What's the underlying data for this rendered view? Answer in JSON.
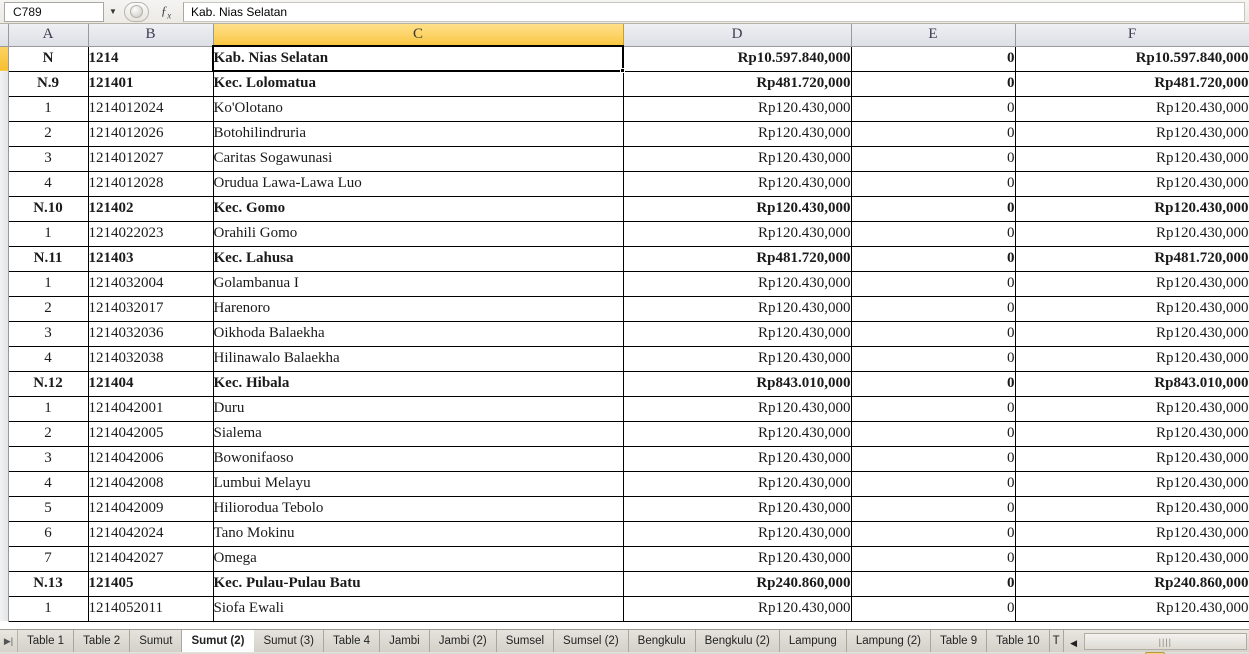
{
  "formula_bar": {
    "name_box_value": "C789",
    "dropdown_icon": "chevron-down-icon",
    "fx_icon": "fx-icon",
    "formula_value": "Kab. Nias Selatan"
  },
  "grid": {
    "columns": [
      {
        "label": "A",
        "selected": false
      },
      {
        "label": "B",
        "selected": false
      },
      {
        "label": "C",
        "selected": true
      },
      {
        "label": "D",
        "selected": false
      },
      {
        "label": "E",
        "selected": false
      },
      {
        "label": "F",
        "selected": false
      }
    ],
    "rows": [
      {
        "bold": true,
        "a": "N",
        "b": "1214",
        "c": "Kab. Nias Selatan",
        "d": "Rp10.597.840,000",
        "e": "0",
        "f": "Rp10.597.840,000"
      },
      {
        "bold": true,
        "a": "N.9",
        "b": "121401",
        "c": "Kec. Lolomatua",
        "d": "Rp481.720,000",
        "e": "0",
        "f": "Rp481.720,000"
      },
      {
        "bold": false,
        "a": "1",
        "b": "1214012024",
        "c": "Ko'Olotano",
        "d": "Rp120.430,000",
        "e": "0",
        "f": "Rp120.430,000"
      },
      {
        "bold": false,
        "a": "2",
        "b": "1214012026",
        "c": "Botohilindruria",
        "d": "Rp120.430,000",
        "e": "0",
        "f": "Rp120.430,000"
      },
      {
        "bold": false,
        "a": "3",
        "b": "1214012027",
        "c": "Caritas Sogawunasi",
        "d": "Rp120.430,000",
        "e": "0",
        "f": "Rp120.430,000"
      },
      {
        "bold": false,
        "a": "4",
        "b": "1214012028",
        "c": "Orudua Lawa-Lawa Luo",
        "d": "Rp120.430,000",
        "e": "0",
        "f": "Rp120.430,000"
      },
      {
        "bold": true,
        "a": "N.10",
        "b": "121402",
        "c": "Kec. Gomo",
        "d": "Rp120.430,000",
        "e": "0",
        "f": "Rp120.430,000"
      },
      {
        "bold": false,
        "a": "1",
        "b": "1214022023",
        "c": "Orahili Gomo",
        "d": "Rp120.430,000",
        "e": "0",
        "f": "Rp120.430,000"
      },
      {
        "bold": true,
        "a": "N.11",
        "b": "121403",
        "c": "Kec. Lahusa",
        "d": "Rp481.720,000",
        "e": "0",
        "f": "Rp481.720,000"
      },
      {
        "bold": false,
        "a": "1",
        "b": "1214032004",
        "c": "Golambanua I",
        "d": "Rp120.430,000",
        "e": "0",
        "f": "Rp120.430,000"
      },
      {
        "bold": false,
        "a": "2",
        "b": "1214032017",
        "c": "Harenoro",
        "d": "Rp120.430,000",
        "e": "0",
        "f": "Rp120.430,000"
      },
      {
        "bold": false,
        "a": "3",
        "b": "1214032036",
        "c": "Oikhoda Balaekha",
        "d": "Rp120.430,000",
        "e": "0",
        "f": "Rp120.430,000"
      },
      {
        "bold": false,
        "a": "4",
        "b": "1214032038",
        "c": "Hilinawalo Balaekha",
        "d": "Rp120.430,000",
        "e": "0",
        "f": "Rp120.430,000"
      },
      {
        "bold": true,
        "a": "N.12",
        "b": "121404",
        "c": "Kec. Hibala",
        "d": "Rp843.010,000",
        "e": "0",
        "f": "Rp843.010,000"
      },
      {
        "bold": false,
        "a": "1",
        "b": "1214042001",
        "c": "Duru",
        "d": "Rp120.430,000",
        "e": "0",
        "f": "Rp120.430,000"
      },
      {
        "bold": false,
        "a": "2",
        "b": "1214042005",
        "c": "Sialema",
        "d": "Rp120.430,000",
        "e": "0",
        "f": "Rp120.430,000"
      },
      {
        "bold": false,
        "a": "3",
        "b": "1214042006",
        "c": "Bowonifaoso",
        "d": "Rp120.430,000",
        "e": "0",
        "f": "Rp120.430,000"
      },
      {
        "bold": false,
        "a": "4",
        "b": "1214042008",
        "c": "Lumbui Melayu",
        "d": "Rp120.430,000",
        "e": "0",
        "f": "Rp120.430,000"
      },
      {
        "bold": false,
        "a": "5",
        "b": "1214042009",
        "c": "Hiliorodua Tebolo",
        "d": "Rp120.430,000",
        "e": "0",
        "f": "Rp120.430,000"
      },
      {
        "bold": false,
        "a": "6",
        "b": "1214042024",
        "c": "Tano Mokinu",
        "d": "Rp120.430,000",
        "e": "0",
        "f": "Rp120.430,000"
      },
      {
        "bold": false,
        "a": "7",
        "b": "1214042027",
        "c": "Omega",
        "d": "Rp120.430,000",
        "e": "0",
        "f": "Rp120.430,000"
      },
      {
        "bold": true,
        "a": "N.13",
        "b": "121405",
        "c": "Kec. Pulau-Pulau Batu",
        "d": "Rp240.860,000",
        "e": "0",
        "f": "Rp240.860,000"
      },
      {
        "bold": false,
        "a": "1",
        "b": "1214052011",
        "c": "Siofa Ewali",
        "d": "Rp120.430,000",
        "e": "0",
        "f": "Rp120.430,000"
      }
    ]
  },
  "sheet_tabs": {
    "nav_first_icon": "nav-first-sheet-icon",
    "scroll_left_icon": "scroll-left-icon",
    "items": [
      {
        "label": "Table 1",
        "active": false
      },
      {
        "label": "Table 2",
        "active": false
      },
      {
        "label": "Sumut",
        "active": false
      },
      {
        "label": "Sumut (2)",
        "active": true
      },
      {
        "label": "Sumut (3)",
        "active": false
      },
      {
        "label": "Table 4",
        "active": false
      },
      {
        "label": "Jambi",
        "active": false
      },
      {
        "label": "Jambi (2)",
        "active": false
      },
      {
        "label": "Sumsel",
        "active": false
      },
      {
        "label": "Sumsel (2)",
        "active": false
      },
      {
        "label": "Bengkulu",
        "active": false
      },
      {
        "label": "Bengkulu (2)",
        "active": false
      },
      {
        "label": "Lampung",
        "active": false
      },
      {
        "label": "Lampung (2)",
        "active": false
      },
      {
        "label": "Table 9",
        "active": false
      },
      {
        "label": "Table 10",
        "active": false
      },
      {
        "label": "T",
        "active": false
      }
    ],
    "scrollbar_grip": "||||"
  },
  "colors": {
    "selection_accent": "#f8c63c",
    "header_bg": "#dcdfe5",
    "grid_line": "#000000",
    "active_tab_bg": "#ffffff"
  }
}
